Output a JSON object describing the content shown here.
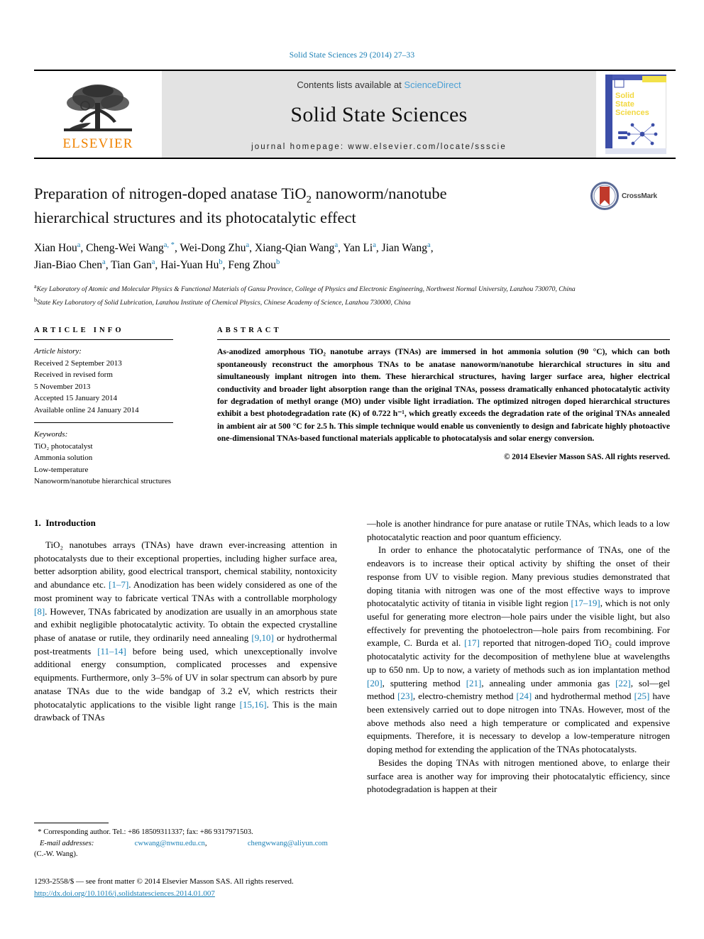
{
  "running_head": "Solid State Sciences 29 (2014) 27–33",
  "masthead": {
    "contents_prefix": "Contents lists available at ",
    "sciencedirect": "ScienceDirect",
    "journal_title": "Solid State Sciences",
    "homepage": "journal homepage: www.elsevier.com/locate/ssscie",
    "publisher_word": "ELSEVIER",
    "cover_title_lines": [
      "Solid",
      "State",
      "Sciences"
    ]
  },
  "article": {
    "title_line1_a": "Preparation of nitrogen-doped anatase TiO",
    "title_line1_sub": "2",
    "title_line1_b": " nanoworm/nanotube",
    "title_line2": "hierarchical structures and its photocatalytic effect",
    "crossmark_label": "CrossMark"
  },
  "authors": {
    "line1": [
      {
        "name": "Xian Hou",
        "sup": "a",
        "sep": ", "
      },
      {
        "name": "Cheng-Wei Wang",
        "sup": "a, *",
        "sep": ", "
      },
      {
        "name": "Wei-Dong Zhu",
        "sup": "a",
        "sep": ", "
      },
      {
        "name": "Xiang-Qian Wang",
        "sup": "a",
        "sep": ", "
      },
      {
        "name": "Yan Li",
        "sup": "a",
        "sep": ", "
      },
      {
        "name": "Jian Wang",
        "sup": "a",
        "sep": ","
      }
    ],
    "line2": [
      {
        "name": "Jian-Biao Chen",
        "sup": "a",
        "sep": ", "
      },
      {
        "name": "Tian Gan",
        "sup": "a",
        "sep": ", "
      },
      {
        "name": "Hai-Yuan Hu",
        "sup": "b",
        "sep": ", "
      },
      {
        "name": "Feng Zhou",
        "sup": "b",
        "sep": ""
      }
    ]
  },
  "affiliations": [
    {
      "sup": "a",
      "text": "Key Laboratory of Atomic and Molecular Physics & Functional Materials of Gansu Province, College of Physics and Electronic Engineering, Northwest Normal University, Lanzhou 730070, China"
    },
    {
      "sup": "b",
      "text": "State Key Laboratory of Solid Lubrication, Lanzhou Institute of Chemical Physics, Chinese Academy of Science, Lanzhou 730000, China"
    }
  ],
  "article_info": {
    "heading": "ARTICLE INFO",
    "history_label": "Article history:",
    "history": [
      "Received 2 September 2013",
      "Received in revised form",
      "5 November 2013",
      "Accepted 15 January 2014",
      "Available online 24 January 2014"
    ],
    "keywords_label": "Keywords:",
    "keywords": [
      "TiO₂ photocatalyst",
      "Ammonia solution",
      "Low-temperature",
      "Nanoworm/nanotube hierarchical structures"
    ]
  },
  "abstract": {
    "heading": "ABSTRACT",
    "text": "As-anodized amorphous TiO₂ nanotube arrays (TNAs) are immersed in hot ammonia solution (90 °C), which can both spontaneously reconstruct the amorphous TNAs to be anatase nanoworm/nanotube hierarchical structures in situ and simultaneously implant nitrogen into them. These hierarchical structures, having larger surface area, higher electrical conductivity and broader light absorption range than the original TNAs, possess dramatically enhanced photocatalytic activity for degradation of methyl orange (MO) under visible light irradiation. The optimized nitrogen doped hierarchical structures exhibit a best photodegradation rate (K) of 0.722 h⁻¹, which greatly exceeds the degradation rate of the original TNAs annealed in ambient air at 500 °C for 2.5 h. This simple technique would enable us conveniently to design and fabricate highly photoactive one-dimensional TNAs-based functional materials applicable to photocatalysis and solar energy conversion.",
    "copyright": "© 2014 Elsevier Masson SAS. All rights reserved."
  },
  "body": {
    "section_number": "1.",
    "section_title": "Introduction",
    "left_paragraphs": [
      "TiO₂ nanotubes arrays (TNAs) have drawn ever-increasing attention in photocatalysts due to their exceptional properties, including higher surface area, better adsorption ability, good electrical transport, chemical stability, nontoxicity and abundance etc. [1–7]. Anodization has been widely considered as one of the most prominent way to fabricate vertical TNAs with a controllable morphology [8]. However, TNAs fabricated by anodization are usually in an amorphous state and exhibit negligible photocatalytic activity. To obtain the expected crystalline phase of anatase or rutile, they ordinarily need annealing [9,10] or hydrothermal post-treatments [11–14] before being used, which unexceptionally involve additional energy consumption, complicated processes and expensive equipments. Furthermore, only 3–5% of UV in solar spectrum can absorb by pure anatase TNAs due to the wide bandgap of 3.2 eV, which restricts their photocatalytic applications to the visible light range [15,16]. This is the main drawback of TNAs"
    ],
    "right_paragraphs": [
      "—hole is another hindrance for pure anatase or rutile TNAs, which leads to a low photocatalytic reaction and poor quantum efficiency.",
      "In order to enhance the photocatalytic performance of TNAs, one of the endeavors is to increase their optical activity by shifting the onset of their response from UV to visible region. Many previous studies demonstrated that doping titania with nitrogen was one of the most effective ways to improve photocatalytic activity of titania in visible light region [17–19], which is not only useful for generating more electron—hole pairs under the visible light, but also effectively for preventing the photoelectron—hole pairs from recombining. For example, C. Burda et al. [17] reported that nitrogen-doped TiO₂ could improve photocatalytic activity for the decomposition of methylene blue at wavelengths up to 650 nm. Up to now, a variety of methods such as ion implantation method [20], sputtering method [21], annealing under ammonia gas [22], sol—gel method [23], electro-chemistry method [24] and hydrothermal method [25] have been extensively carried out to dope nitrogen into TNAs. However, most of the above methods also need a high temperature or complicated and expensive equipments. Therefore, it is necessary to develop a low-temperature nitrogen doping method for extending the application of the TNAs photocatalysts.",
      "Besides the doping TNAs with nitrogen mentioned above, to enlarge their surface area is another way for improving their photocatalytic efficiency, since photodegradation is happen at their"
    ]
  },
  "footer": {
    "corresponding_star": "*",
    "corresponding_text": "Corresponding author. Tel.: +86 18509311337; fax: +86 9317971503.",
    "email_label": "E-mail addresses:",
    "email1": "cwwang@nwnu.edu.cn",
    "email_sep": ",",
    "email2": "chengwwang@aliyun.com",
    "email_owner": "(C.-W. Wang).",
    "issn_line": "1293-2558/$ — see front matter © 2014 Elsevier Masson SAS. All rights reserved.",
    "doi": "http://dx.doi.org/10.1016/j.solidstatesciences.2014.01.007"
  },
  "colors": {
    "link": "#1a7fb5",
    "elsevier_orange": "#ef8200",
    "masthead_grey": "#e3e3e3",
    "sciencedirect": "#4a9fd4"
  }
}
